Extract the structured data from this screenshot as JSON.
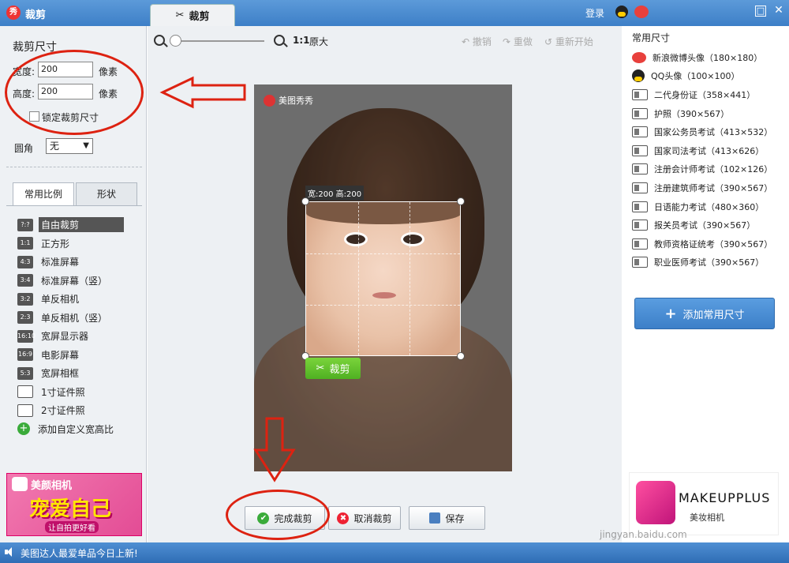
{
  "title_bar": {
    "logo": "秀",
    "app_title": "裁剪",
    "tab_label": "裁剪",
    "login": "登录",
    "restore_symbol": "□",
    "close_symbol": "✕"
  },
  "left": {
    "heading": "裁剪尺寸",
    "width_label": "宽度:",
    "width_value": "200",
    "height_label": "高度:",
    "height_value": "200",
    "unit": "像素",
    "lock_label": "锁定裁剪尺寸",
    "corner_label": "圆角",
    "corner_value": "无",
    "tabs": [
      {
        "label": "常用比例",
        "active": true
      },
      {
        "label": "形状",
        "active": false
      }
    ],
    "ratios": [
      {
        "icon": "?:?",
        "label": "自由裁剪",
        "selected": true
      },
      {
        "icon": "1:1",
        "label": "正方形"
      },
      {
        "icon": "4:3",
        "label": "标准屏幕"
      },
      {
        "icon": "3:4",
        "label": "标准屏幕（竖）"
      },
      {
        "icon": "3:2",
        "label": "单反相机"
      },
      {
        "icon": "2:3",
        "label": "单反相机（竖）"
      },
      {
        "icon": "16:10",
        "label": "宽屏显示器"
      },
      {
        "icon": "16:9",
        "label": "电影屏幕"
      },
      {
        "icon": "5:3",
        "label": "宽屏相框"
      },
      {
        "icon": "card",
        "label": "1寸证件照"
      },
      {
        "icon": "card",
        "label": "2寸证件照"
      },
      {
        "icon": "+",
        "label": "添加自定义宽高比"
      }
    ],
    "ad": {
      "line1": "美颜相机",
      "line2": "宠爱自己",
      "line3": "让自拍更好看"
    }
  },
  "center": {
    "zoom_label": "1:1",
    "original_label": "原大",
    "undo": "撤销",
    "redo": "重做",
    "restart": "重新开始",
    "watermark": "美图秀秀",
    "crop_dims": "宽:200 高:200",
    "crop_button": "裁剪",
    "finish_button": "完成裁剪",
    "cancel_button": "取消裁剪",
    "save_button": "保存"
  },
  "right": {
    "heading": "常用尺寸",
    "sizes": [
      {
        "icon": "weibo-icon",
        "label": "新浪微博头像（180×180）"
      },
      {
        "icon": "qq-icon",
        "label": "QQ头像（100×100）"
      },
      {
        "icon": "id-card-icon",
        "label": "二代身份证（358×441）"
      },
      {
        "icon": "id-card-icon",
        "label": "护照（390×567）"
      },
      {
        "icon": "id-card-icon",
        "label": "国家公务员考试（413×532）"
      },
      {
        "icon": "id-card-icon",
        "label": "国家司法考试（413×626）"
      },
      {
        "icon": "id-card-icon",
        "label": "注册会计师考试（102×126）"
      },
      {
        "icon": "id-card-icon",
        "label": "注册建筑师考试（390×567）"
      },
      {
        "icon": "id-card-icon",
        "label": "日语能力考试（480×360）"
      },
      {
        "icon": "id-card-icon",
        "label": "报关员考试（390×567）"
      },
      {
        "icon": "id-card-icon",
        "label": "教师资格证统考（390×567）"
      },
      {
        "icon": "id-card-icon",
        "label": "职业医师考试（390×567）"
      }
    ],
    "add_button": "添加常用尺寸",
    "ad": {
      "line1": "MAKEUPPLUS",
      "line2": "美妆相机"
    }
  },
  "status": {
    "text": "美图达人最爱单品今日上新!",
    "watermark": "jingyan.baidu.com"
  },
  "colors": {
    "accent_blue": "#3d7fc7",
    "annotation_red": "#d21",
    "crop_green": "#4fb022"
  }
}
